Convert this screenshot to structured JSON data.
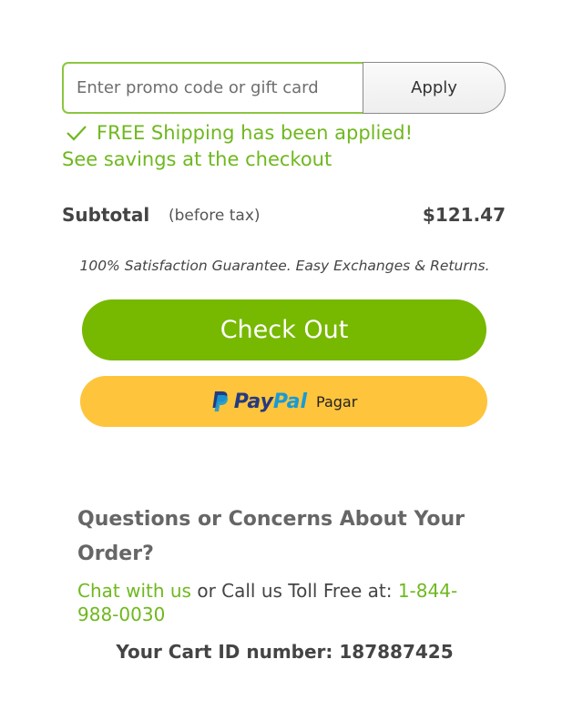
{
  "promo": {
    "placeholder": "Enter promo code or gift card",
    "value": "",
    "apply_label": "Apply"
  },
  "shipping": {
    "icon": "checkmark-icon",
    "message": "FREE Shipping has been applied!",
    "savings": "See savings at the checkout"
  },
  "subtotal": {
    "label": "Subtotal",
    "note": "(before tax)",
    "value": "$121.47"
  },
  "guarantee": "100% Satisfaction Guarantee. Easy Exchanges & Returns.",
  "checkout": {
    "label": "Check Out",
    "color": "#77b800"
  },
  "paypal": {
    "icon": "paypal-p-icon",
    "brand_pay": "Pay",
    "brand_pal": "Pal",
    "action": "Pagar",
    "color": "#fec43c"
  },
  "support": {
    "heading": "Questions or Concerns About Your Order?",
    "chat_link": "Chat with us",
    "call_text": " or Call us Toll Free at: ",
    "phone": "1-844-988-0030"
  },
  "cart": {
    "id_text": "Your Cart ID number: 187887425"
  },
  "colors": {
    "accent_green": "#6fb81e",
    "promo_border": "#8cc63f"
  }
}
